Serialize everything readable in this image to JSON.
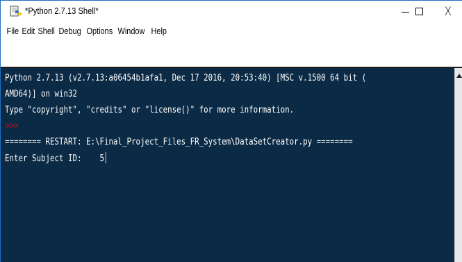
{
  "window": {
    "title": "*Python 2.7.13 Shell*",
    "controls": {
      "minimize": "minimize",
      "maximize": "maximize",
      "close": "close"
    }
  },
  "menu": [
    "File",
    "Edit",
    "Shell",
    "Debug",
    "Options",
    "Window",
    "Help"
  ],
  "shell": {
    "lines": [
      "Python 2.7.13 (v2.7.13:a06454b1afa1, Dec 17 2016, 20:53:40) [MSC v.1500 64 bit (",
      "AMD64)] on win32",
      "Type \"copyright\", \"credits\" or \"license()\" for more information.",
      ">>>",
      "======== RESTART: E:\\Final_Project_Files_FR_System\\DataSetCreator.py ========",
      "Enter Subject ID:    5"
    ],
    "prompt": ">>>",
    "input_label": "Enter Subject ID:    ",
    "input_value": "5"
  },
  "colors": {
    "shell_bg": "#0b2a45",
    "text": "#ffffff",
    "prompt": "#c81414"
  }
}
